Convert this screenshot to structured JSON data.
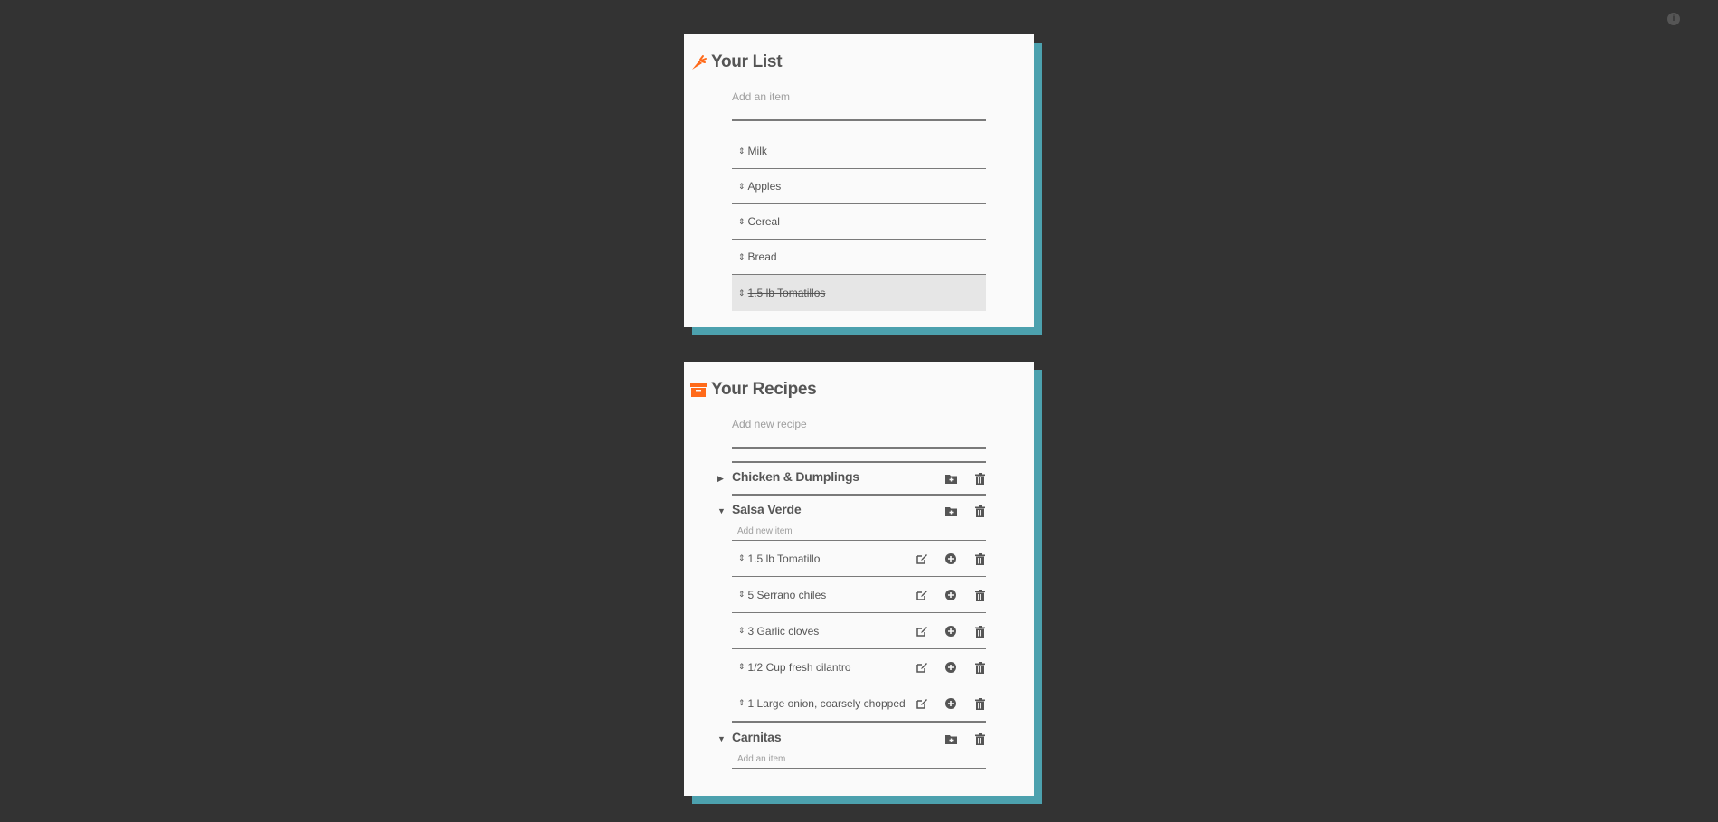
{
  "header": {
    "info_icon": "info-circle-icon"
  },
  "list_card": {
    "title": "Your List",
    "icon": "carrot-icon",
    "add_placeholder": "Add an item",
    "add_value": "",
    "items": [
      {
        "label": "Milk",
        "done": false
      },
      {
        "label": "Apples",
        "done": false
      },
      {
        "label": "Cereal",
        "done": false
      },
      {
        "label": "Bread",
        "done": false
      },
      {
        "label": "1.5 lb Tomatillos",
        "done": true
      }
    ]
  },
  "recipes_card": {
    "title": "Your Recipes",
    "icon": "archive-box-icon",
    "add_placeholder": "Add new recipe",
    "add_value": "",
    "recipes": [
      {
        "name": "Chicken & Dumplings",
        "expanded": false,
        "ingredients": []
      },
      {
        "name": "Salsa Verde",
        "expanded": true,
        "add_placeholder": "Add new item",
        "ingredients": [
          "1.5 lb Tomatillo",
          "5 Serrano chiles",
          "3 Garlic cloves",
          "1/2 Cup fresh cilantro",
          "1 Large onion, coarsely chopped"
        ]
      },
      {
        "name": "Carnitas",
        "expanded": true,
        "add_placeholder": "Add an item",
        "ingredients": []
      }
    ]
  },
  "colors": {
    "accent": "#ff6a1a",
    "shadow": "#4ca1ae",
    "background": "#333333",
    "card": "#fafafa",
    "text": "#555555"
  }
}
